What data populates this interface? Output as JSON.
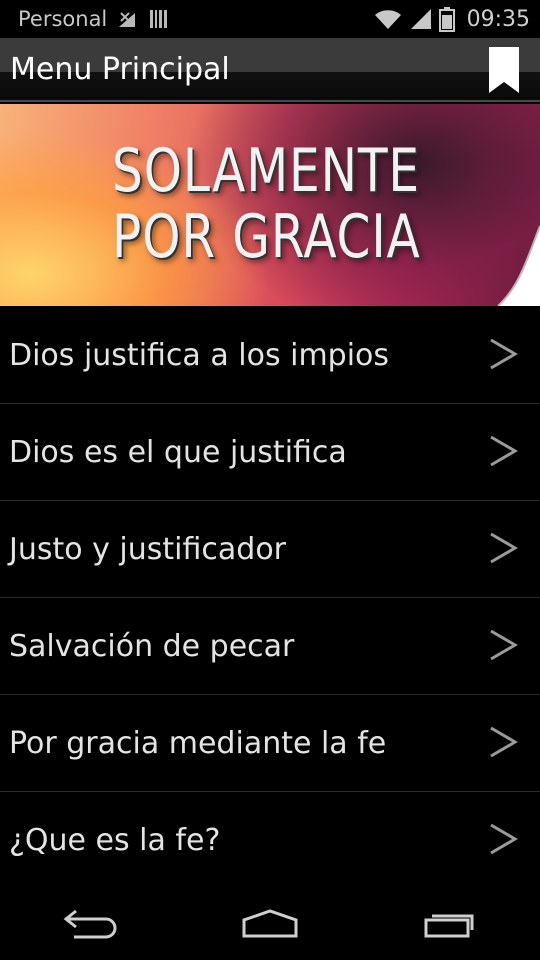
{
  "status_bar": {
    "carrier": "Personal",
    "time": "09:35",
    "icons": [
      "signal-off-icon",
      "barcode-icon",
      "wifi-icon",
      "cell-signal-icon",
      "battery-icon"
    ]
  },
  "action_bar": {
    "title": "Menu Principal",
    "bookmark_icon": "bookmark-icon"
  },
  "banner": {
    "line1": "SOLAMENTE",
    "line2": "POR GRACIA",
    "colors": [
      "#f8b27a",
      "#d94a5a",
      "#6a1a3a"
    ]
  },
  "menu": {
    "items": [
      {
        "label": "Dios justifica a los impios"
      },
      {
        "label": "Dios es el que justifica"
      },
      {
        "label": "Justo y justificador"
      },
      {
        "label": "Salvación de pecar"
      },
      {
        "label": "Por gracia mediante la fe"
      },
      {
        "label": "¿Que es la fe?"
      }
    ],
    "chevron_icon": "chevron-right-icon"
  },
  "nav_bar": {
    "icons": [
      "back-icon",
      "home-icon",
      "recent-apps-icon"
    ]
  }
}
